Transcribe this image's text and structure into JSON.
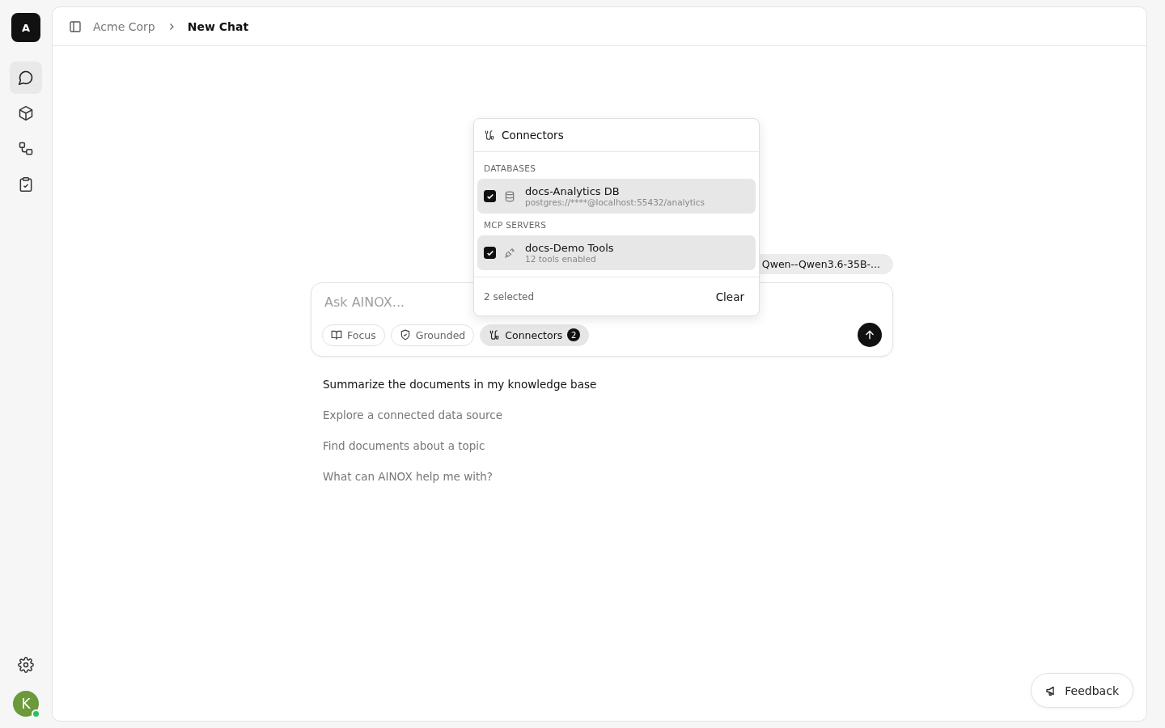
{
  "sidebar": {
    "logo": "A",
    "items": [
      {
        "kind": "chat",
        "selected": true
      },
      {
        "kind": "cube",
        "selected": false
      },
      {
        "kind": "flow",
        "selected": false
      },
      {
        "kind": "clipboard",
        "selected": false
      }
    ],
    "avatar": {
      "initial": "K",
      "online": true
    }
  },
  "breadcrumb": [
    "Acme Corp",
    "New Chat"
  ],
  "model_pill": "Qwen--Qwen3.6-35B-...",
  "composer": {
    "placeholder": "Ask AINOX...",
    "chips": [
      {
        "kind": "focus",
        "label": "Focus",
        "active": false
      },
      {
        "kind": "grounded",
        "label": "Grounded",
        "active": false
      },
      {
        "kind": "connectors",
        "label": "Connectors",
        "active": true,
        "count": "2"
      }
    ]
  },
  "connectors_popover": {
    "title": "Connectors",
    "sections": [
      {
        "heading": "DATABASES",
        "items": [
          {
            "kind": "database",
            "name": "docs-Analytics DB",
            "detail": "postgres://****@localhost:55432/analytics",
            "checked": true
          }
        ]
      },
      {
        "heading": "MCP SERVERS",
        "items": [
          {
            "kind": "plug",
            "name": "docs-Demo Tools",
            "detail": "12 tools enabled",
            "checked": true
          }
        ]
      }
    ],
    "footer": "2 selected",
    "clear": "Clear"
  },
  "suggestions": [
    {
      "text": "Summarize the documents in my knowledge base",
      "selected": true
    },
    {
      "text": "Explore a connected data source",
      "selected": false
    },
    {
      "text": "Find documents about a topic",
      "selected": false
    },
    {
      "text": "What can AINOX help me with?",
      "selected": false
    }
  ],
  "feedback": "Feedback"
}
